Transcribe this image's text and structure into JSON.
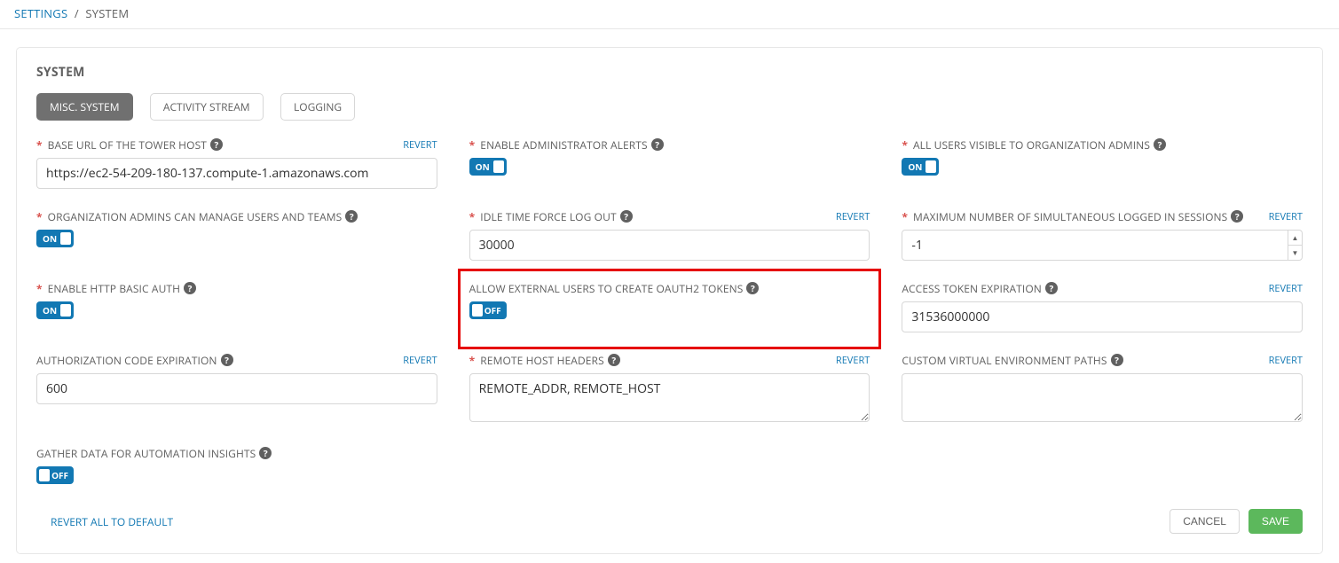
{
  "breadcrumb": {
    "root": "SETTINGS",
    "sep": "/",
    "current": "SYSTEM"
  },
  "panel": {
    "title": "SYSTEM"
  },
  "tabs": {
    "misc": "MISC. SYSTEM",
    "activity": "ACTIVITY STREAM",
    "logging": "LOGGING"
  },
  "labels": {
    "revert": "REVERT",
    "on": "ON",
    "off": "OFF"
  },
  "fields": {
    "base_url": {
      "required": true,
      "label": "BASE URL OF THE TOWER HOST",
      "value": "https://ec2-54-209-180-137.compute-1.amazonaws.com",
      "revert": true
    },
    "admin_alerts": {
      "required": true,
      "label": "ENABLE ADMINISTRATOR ALERTS",
      "toggle": "on"
    },
    "all_users_visible": {
      "required": true,
      "label": "ALL USERS VISIBLE TO ORGANIZATION ADMINS",
      "toggle": "on"
    },
    "org_admins_manage": {
      "required": true,
      "label": "ORGANIZATION ADMINS CAN MANAGE USERS AND TEAMS",
      "toggle": "on"
    },
    "idle_time": {
      "required": true,
      "label": "IDLE TIME FORCE LOG OUT",
      "value": "30000",
      "revert": true
    },
    "max_sessions": {
      "required": true,
      "label": "MAXIMUM NUMBER OF SIMULTANEOUS LOGGED IN SESSIONS",
      "value": "-1",
      "revert": true
    },
    "http_basic": {
      "required": true,
      "label": "ENABLE HTTP BASIC AUTH",
      "toggle": "on"
    },
    "external_oauth": {
      "required": false,
      "label": "ALLOW EXTERNAL USERS TO CREATE OAUTH2 TOKENS",
      "toggle": "off"
    },
    "access_token_exp": {
      "required": false,
      "label": "ACCESS TOKEN EXPIRATION",
      "value": "31536000000",
      "revert": true
    },
    "auth_code_exp": {
      "required": false,
      "label": "AUTHORIZATION CODE EXPIRATION",
      "value": "600",
      "revert": true
    },
    "remote_host_headers": {
      "required": true,
      "label": "REMOTE HOST HEADERS",
      "value": "REMOTE_ADDR, REMOTE_HOST",
      "revert": true
    },
    "custom_venv": {
      "required": false,
      "label": "CUSTOM VIRTUAL ENVIRONMENT PATHS",
      "value": "",
      "revert": true
    },
    "gather_insights": {
      "required": false,
      "label": "GATHER DATA FOR AUTOMATION INSIGHTS",
      "toggle": "off"
    }
  },
  "footer": {
    "revert_all": "REVERT ALL TO DEFAULT",
    "cancel": "CANCEL",
    "save": "SAVE"
  }
}
